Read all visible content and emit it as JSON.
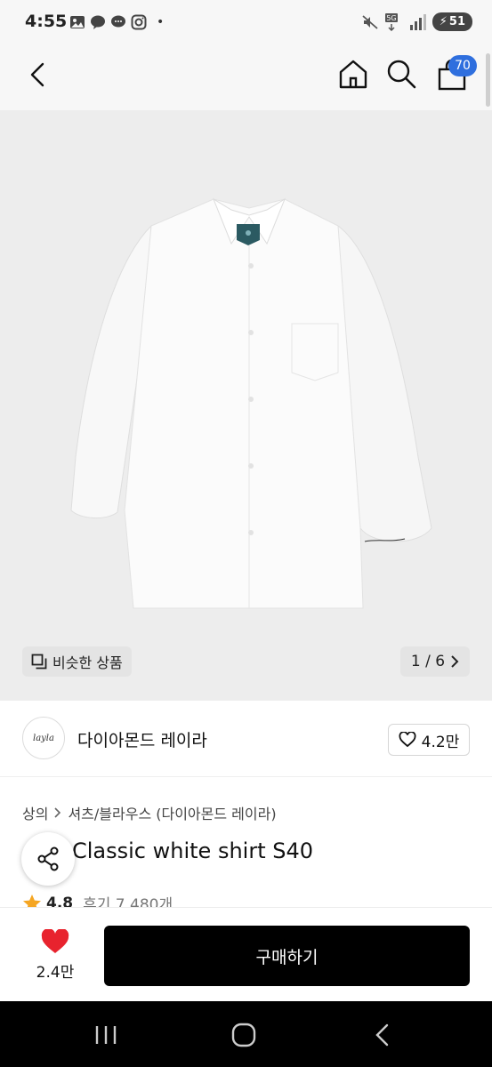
{
  "status_bar": {
    "time": "4:55",
    "battery": "51",
    "network": "5G"
  },
  "nav": {
    "cart_count": "70"
  },
  "gallery": {
    "similar_label": "비슷한 상품",
    "pager": "1 / 6"
  },
  "brand": {
    "logo_text": "layla",
    "name": "다이아몬드 레이라",
    "likes": "4.2만"
  },
  "breadcrumb": {
    "category": "상의",
    "subcategory": "셔츠/블라우스 (다이아몬드 레이라)"
  },
  "product": {
    "title": "Classic white shirt S40",
    "rating": "4.8",
    "reviews": "후기 7,480개"
  },
  "buy_bar": {
    "wish_count": "2.4만",
    "buy_label": "구매하기"
  },
  "colors": {
    "accent_badge": "#2f6fde",
    "heart": "#e8232e",
    "star": "#f5a623",
    "buy_button": "#000000"
  },
  "icons": [
    "back-icon",
    "home-icon",
    "search-icon",
    "cart-icon",
    "share-icon",
    "heart-icon",
    "star-icon",
    "similar-icon"
  ]
}
